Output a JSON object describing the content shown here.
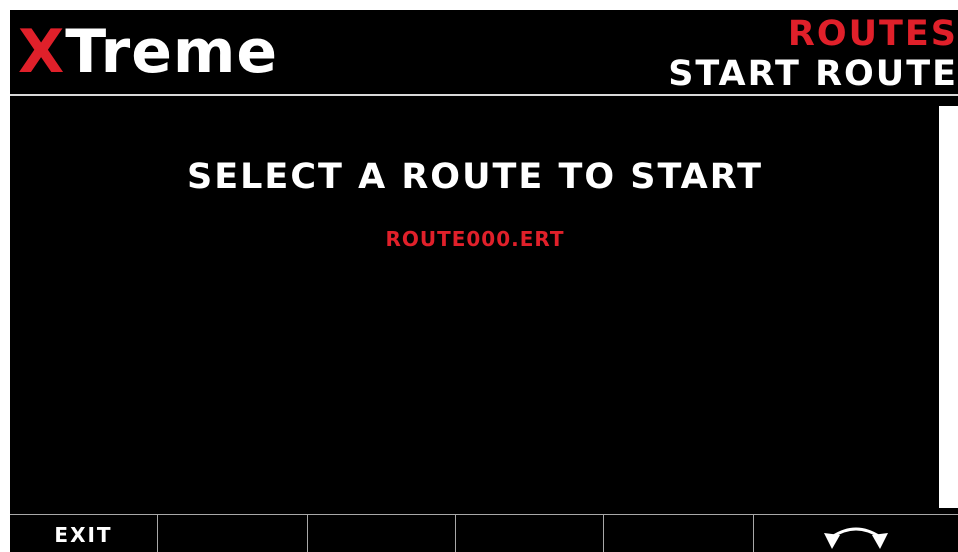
{
  "header": {
    "logo_x": "X",
    "logo_rest": "Treme",
    "title": "ROUTES",
    "subtitle": "START ROUTE"
  },
  "main": {
    "prompt": "SELECT A ROUTE TO START",
    "routes": [
      "ROUTE000.ERT"
    ],
    "selected_route_index": 0
  },
  "softkeys": [
    {
      "label": "EXIT"
    },
    {
      "label": ""
    },
    {
      "label": ""
    },
    {
      "label": ""
    },
    {
      "label": ""
    },
    {
      "label": "",
      "icon": "rotary-knob-icon"
    }
  ],
  "colors": {
    "background": "#000000",
    "text": "#ffffff",
    "accent_red": "#e0202a"
  }
}
